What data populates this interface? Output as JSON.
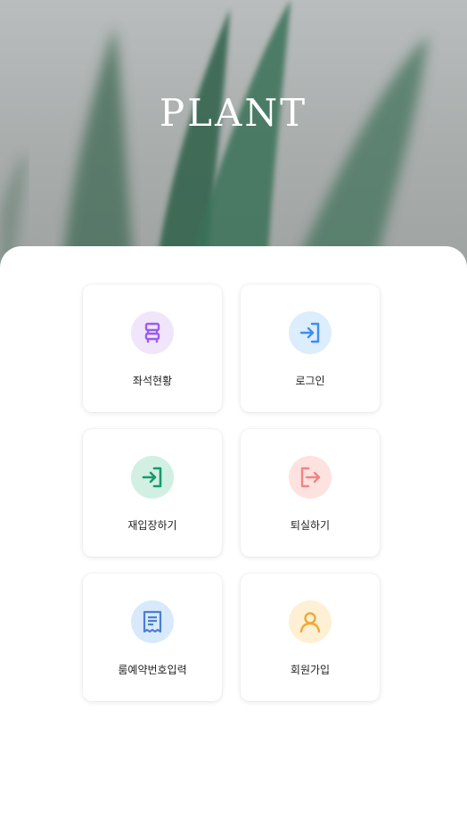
{
  "app": {
    "title": "PLANT"
  },
  "menu": {
    "seat_status": {
      "label": "좌석현황",
      "icon": "seat-icon",
      "bg": "#f0e5fb",
      "color": "#9b5cf0"
    },
    "login": {
      "label": "로그인",
      "icon": "login-icon",
      "bg": "#dcedfd",
      "color": "#3d8ef0"
    },
    "reentry": {
      "label": "재입장하기",
      "icon": "reentry-icon",
      "bg": "#d2efe4",
      "color": "#179a6e"
    },
    "checkout": {
      "label": "퇴실하기",
      "icon": "logout-icon",
      "bg": "#fde2df",
      "color": "#ee8585"
    },
    "room_reservation": {
      "label": "룸예약번호입력",
      "icon": "receipt-icon",
      "bg": "#d9e9fc",
      "color": "#4a7fcf"
    },
    "signup": {
      "label": "회원가입",
      "icon": "user-icon",
      "bg": "#fef0d4",
      "color": "#f0a93a"
    }
  }
}
